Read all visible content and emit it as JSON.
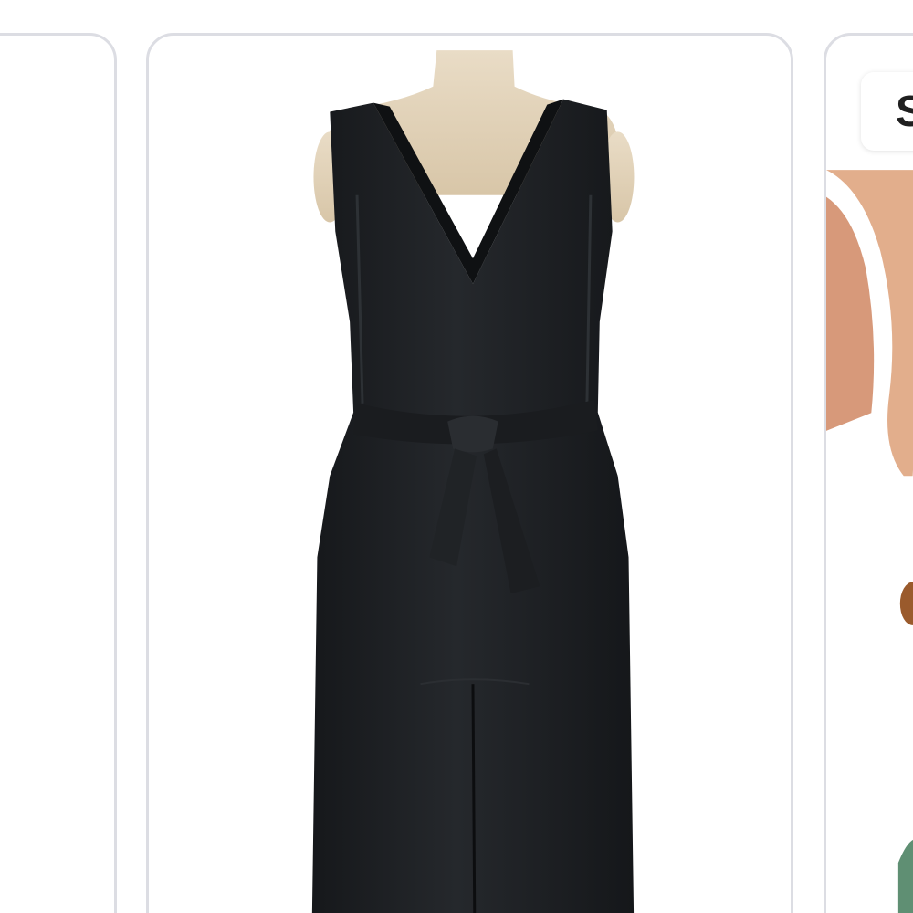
{
  "carousel": {
    "cards": [
      {
        "name": "previous-product-card"
      },
      {
        "name": "product-card-black-dress",
        "image": "product-photo"
      },
      {
        "name": "next-product-card",
        "image": "product-photo",
        "badge_label": "S"
      }
    ]
  },
  "colors": {
    "card_border": "#dcdde3",
    "background": "#ffffff",
    "dress": "#1e2124"
  }
}
